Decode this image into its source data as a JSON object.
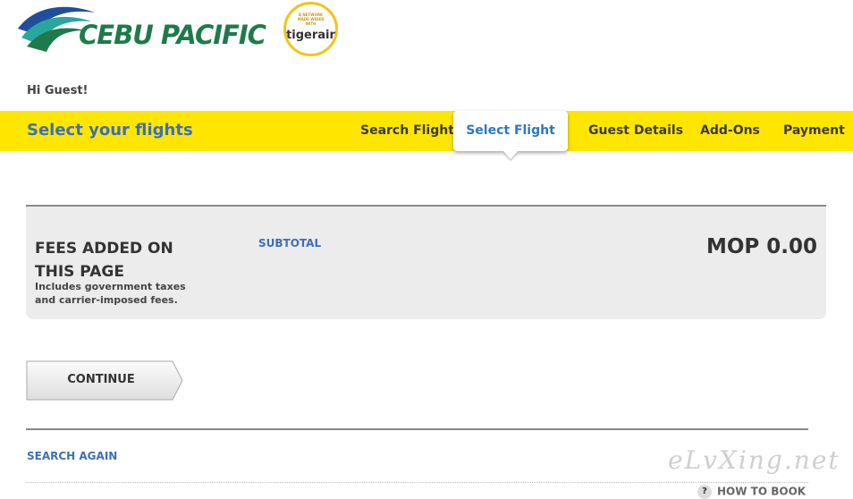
{
  "brand": {
    "name": "CEBU PACIFIC",
    "partner_tagline": "A NETWORK MADE WIDER WITH",
    "partner_name": "tigerair",
    "swoosh_colors": [
      "#1f4f9c",
      "#2aa79c",
      "#1e7a4a"
    ]
  },
  "greeting": "Hi Guest!",
  "steps_bar": {
    "heading": "Select your flights",
    "steps": [
      {
        "label": "Search Flight",
        "active": false
      },
      {
        "label": "Select Flight",
        "active": true
      },
      {
        "label": "Guest Details",
        "active": false
      },
      {
        "label": "Add-Ons",
        "active": false
      },
      {
        "label": "Payment",
        "active": false
      }
    ],
    "bar_color": "#ffe600"
  },
  "fees": {
    "title": "FEES ADDED ON THIS PAGE",
    "note": "Includes government taxes and carrier-imposed fees.",
    "subtotal_label": "SUBTOTAL",
    "amount": "MOP 0.00"
  },
  "actions": {
    "continue_label": "CONTINUE",
    "search_again_label": "SEARCH AGAIN",
    "help_icon": "?",
    "help_label": "HOW TO BOOK"
  },
  "watermark": "eLvXing.net",
  "colors": {
    "accent_blue": "#3d6fb6",
    "brand_green": "#1e7a4a"
  }
}
